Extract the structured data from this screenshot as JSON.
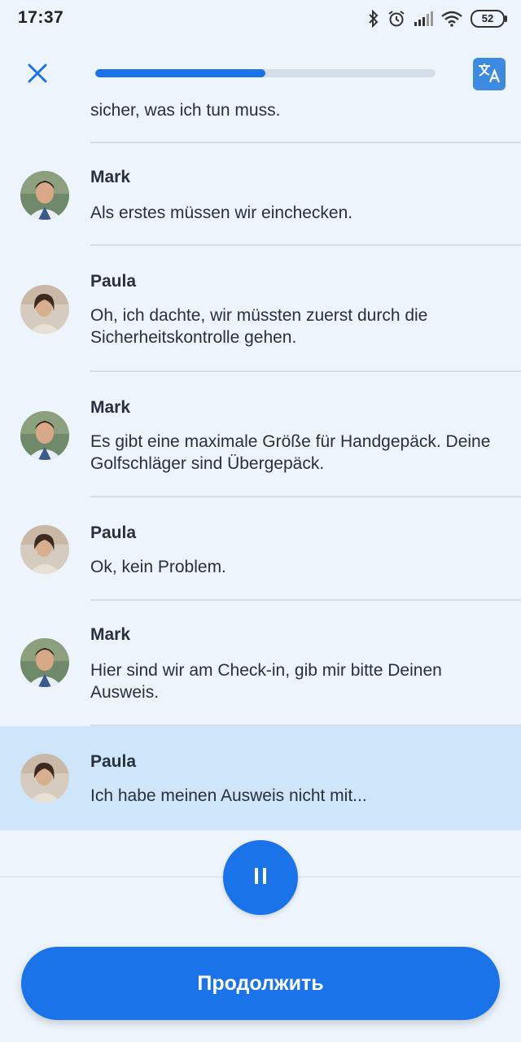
{
  "status_bar": {
    "time": "17:37",
    "battery": "52"
  },
  "header": {
    "close_icon": "close-icon",
    "progress_fraction": 0.5,
    "translate_icon": "translate-icon"
  },
  "chat": {
    "partial_text": "sicher, was ich tun muss.",
    "messages": [
      {
        "speaker": "Mark",
        "text": "Als erstes müssen wir einchecken."
      },
      {
        "speaker": "Paula",
        "text": "Oh, ich dachte, wir müssten zuerst durch die Sicherheitskontrolle gehen."
      },
      {
        "speaker": "Mark",
        "text": "Es gibt eine maximale Größe für Handgepäck. Deine Golfschläger sind Übergepäck."
      },
      {
        "speaker": "Paula",
        "text": "Ok, kein Problem."
      },
      {
        "speaker": "Mark",
        "text": "Hier sind wir am Check-in, gib mir bitte Deinen Ausweis."
      },
      {
        "speaker": "Paula",
        "text": "Ich habe meinen Ausweis nicht mit..."
      }
    ]
  },
  "controls": {
    "pause_icon": "pause-icon",
    "continue_label": "Продолжить"
  },
  "colors": {
    "accent": "#1a73e8",
    "highlight": "#cfe6fa",
    "background": "#eef4fb"
  }
}
